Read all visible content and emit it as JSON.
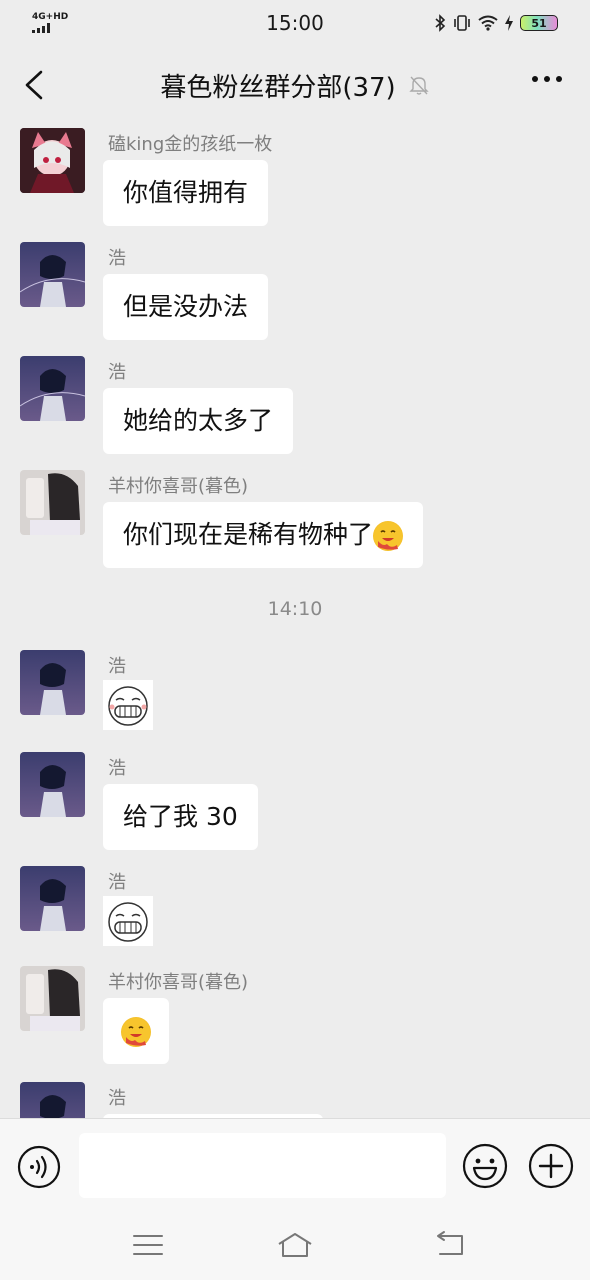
{
  "status_bar": {
    "network": "4G+HD",
    "time": "15:00",
    "battery": "51"
  },
  "header": {
    "title": "暮色粉丝群分部(37)"
  },
  "messages": [
    {
      "sender": "磕king金的孩纸一枚",
      "text": "你值得拥有",
      "avatar": "pink-anime-girl"
    },
    {
      "sender": "浩",
      "text": "但是没办法",
      "avatar": "dark-anime-boy"
    },
    {
      "sender": "浩",
      "text": "她给的太多了",
      "avatar": "dark-anime-boy"
    },
    {
      "sender": "羊村你喜哥(暮色)",
      "text": "你们现在是稀有物种了",
      "avatar": "photo-figure",
      "emoji": "drooling-face"
    },
    {
      "sender": "浩",
      "sticker": "grin-sticker",
      "avatar": "dark-anime-boy"
    },
    {
      "sender": "浩",
      "text": "给了我 30",
      "avatar": "dark-anime-boy"
    },
    {
      "sender": "浩",
      "sticker": "grin-sticker",
      "avatar": "dark-anime-boy"
    },
    {
      "sender": "羊村你喜哥(暮色)",
      "emoji": "drooling-face",
      "avatar": "photo-figure"
    },
    {
      "sender": "浩",
      "avatar": "dark-anime-boy"
    }
  ],
  "timestamp": "14:10",
  "input": {
    "value": "",
    "placeholder": ""
  },
  "colors": {
    "background": "#ededed",
    "bubble": "#ffffff",
    "sender": "#7f7f7f"
  }
}
